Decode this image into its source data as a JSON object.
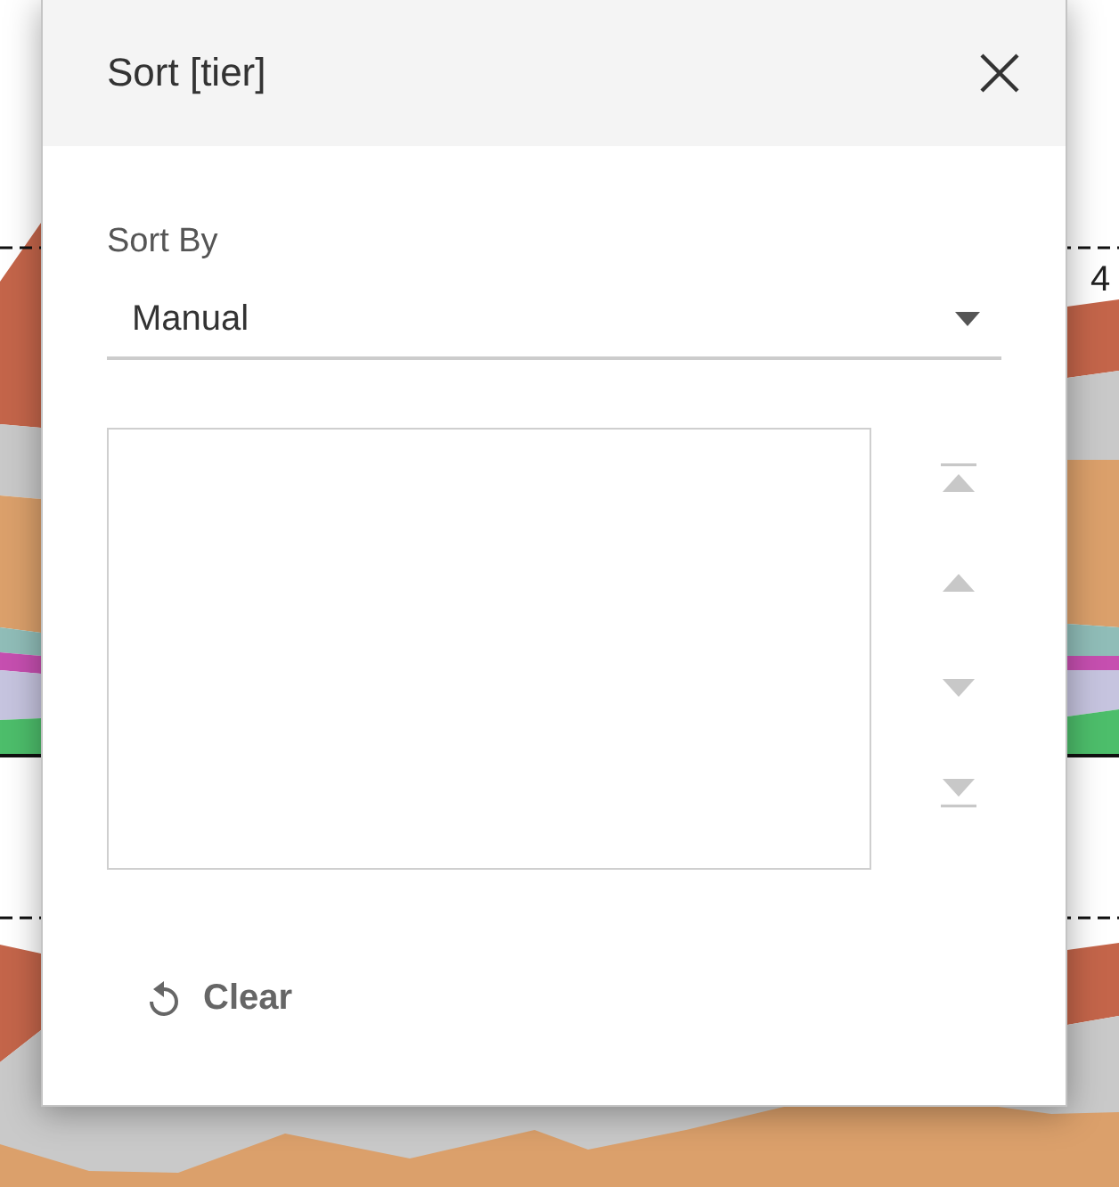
{
  "background_chart": {
    "axis_label": "4"
  },
  "dialog": {
    "title": "Sort [tier]",
    "sort_by": {
      "label": "Sort By",
      "value": "Manual"
    },
    "move_buttons": [
      {
        "kind": "top",
        "disabled": true
      },
      {
        "kind": "up",
        "disabled": true
      },
      {
        "kind": "down",
        "disabled": true
      },
      {
        "kind": "bottom",
        "disabled": true
      }
    ],
    "clear_button": {
      "label": "Clear"
    }
  }
}
